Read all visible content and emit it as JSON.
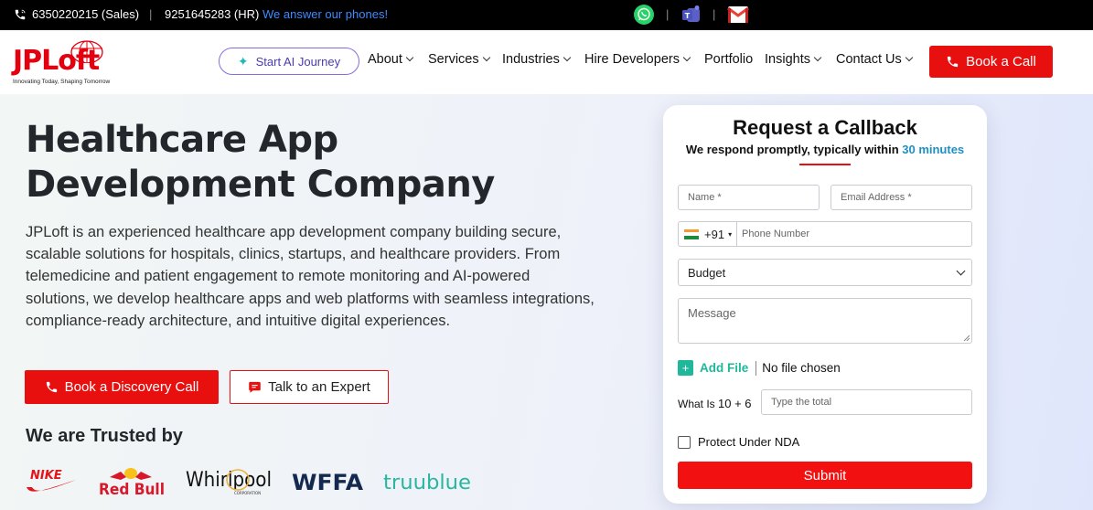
{
  "topbar": {
    "sales_phone": "6350220215 (Sales)",
    "hr_phone": "9251645283 (HR)",
    "tagline": "We answer our phones!",
    "separator": "|",
    "icons": [
      "whatsapp-icon",
      "teams-icon",
      "gmail-icon"
    ]
  },
  "logo": {
    "brand_a": "JP",
    "brand_b": "Loft",
    "tag": "Innovating Today, Shaping Tomorrow"
  },
  "nav": {
    "ai_label": "Start AI Journey",
    "items": [
      "About",
      "Services",
      "Industries",
      "Hire Developers",
      "Portfolio",
      "Insights",
      "Contact Us"
    ],
    "book_label": "Book a Call"
  },
  "hero": {
    "title_line1": "Healthcare App",
    "title_line2": "Development Company",
    "description": "JPLoft is an experienced healthcare app development company building secure, scalable solutions for hospitals, clinics, startups, and healthcare providers. From telemedicine and patient engagement to remote monitoring and AI-powered solutions, we develop healthcare apps and web platforms with seamless integrations, compliance-ready architecture, and intuitive digital experiences.",
    "cta_primary": "Book a Discovery Call",
    "cta_secondary": "Talk to an Expert",
    "trusted_heading": "We are Trusted by",
    "brands": {
      "nike": "NIKE",
      "redbull": "Red Bull",
      "whirlpool": "Whirlpool",
      "whirlpool_sub": "CORPORATION",
      "wffa": "WFFA",
      "truublue": "truublue"
    }
  },
  "form": {
    "title": "Request a Callback",
    "subtitle_pre": "We respond promptly, typically within ",
    "subtitle_highlight": "30 minutes",
    "name_placeholder": "Name *",
    "email_placeholder": "Email Address *",
    "phone_code": "+91",
    "phone_placeholder": "Phone Number",
    "budget_selected": "Budget",
    "message_placeholder": "Message",
    "add_file": "Add File",
    "no_file": "No file chosen",
    "captcha_label": "What Is ",
    "captcha_question": "10 + 6",
    "captcha_placeholder": "Type the total",
    "nda_label": "Protect Under NDA",
    "submit_label": "Submit"
  },
  "colors": {
    "accent_red": "#e80f0f",
    "highlight_blue": "#1f8fc5",
    "file_green": "#1fb89b"
  }
}
